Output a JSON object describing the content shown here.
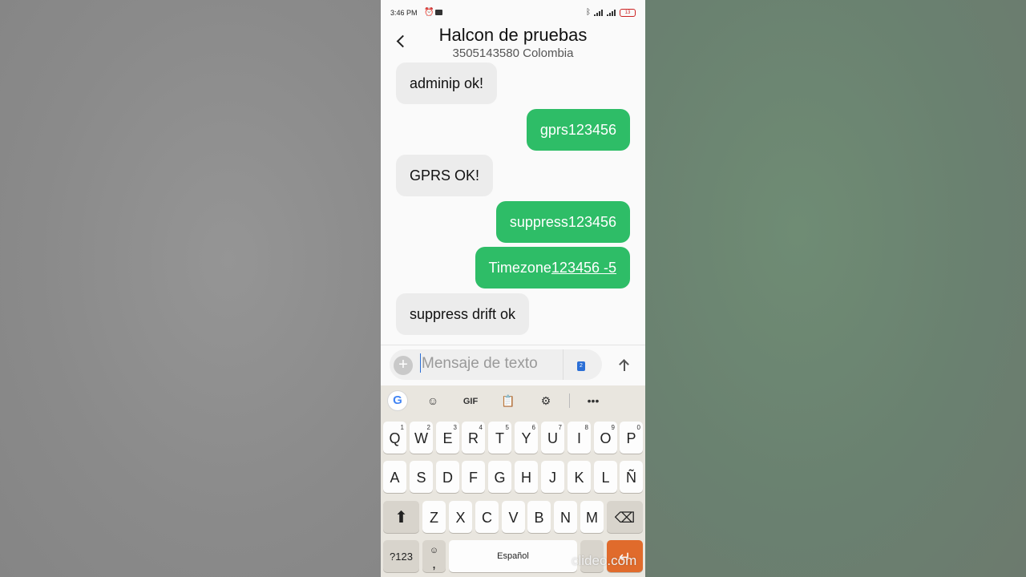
{
  "status_bar": {
    "time": "3:46 PM",
    "battery": "13"
  },
  "conversation": {
    "title": "Halcon de pruebas",
    "subtitle": "3505143580 Colombia",
    "messages": [
      {
        "dir": "in",
        "text": "adminip ok!"
      },
      {
        "dir": "out",
        "text": "gprs123456"
      },
      {
        "dir": "in",
        "text": "GPRS OK!"
      },
      {
        "dir": "out",
        "text": "suppress123456"
      },
      {
        "dir": "out",
        "text_plain": "Timezone",
        "text_link": "123456 -5"
      },
      {
        "dir": "in",
        "text": "suppress drift ok"
      }
    ]
  },
  "composer": {
    "placeholder": "Mensaje de texto",
    "sim_label": "2"
  },
  "keyboard": {
    "toolbar": {
      "google": "G",
      "gif": "GIF",
      "more": "•••"
    },
    "row1": [
      "Q",
      "W",
      "E",
      "R",
      "T",
      "Y",
      "U",
      "I",
      "O",
      "P"
    ],
    "row1_hints": [
      "1",
      "2",
      "3",
      "4",
      "5",
      "6",
      "7",
      "8",
      "9",
      "0"
    ],
    "row2": [
      "A",
      "S",
      "D",
      "F",
      "G",
      "H",
      "J",
      "K",
      "L",
      "Ñ"
    ],
    "row3": [
      "Z",
      "X",
      "C",
      "V",
      "B",
      "N",
      "M"
    ],
    "symbols_label": "?123",
    "comma": ",",
    "space_label": "Español"
  },
  "watermark": "clideo.com",
  "icons": {
    "back": "chevron-left-icon",
    "send": "arrow-up-icon",
    "plus": "plus-icon",
    "shift": "shift-icon",
    "backspace": "backspace-icon",
    "enter": "enter-icon",
    "emoji": "emoji-icon"
  },
  "colors": {
    "outgoing": "#2ebd67",
    "incoming": "#ececec",
    "enter_key": "#e06b2c"
  }
}
